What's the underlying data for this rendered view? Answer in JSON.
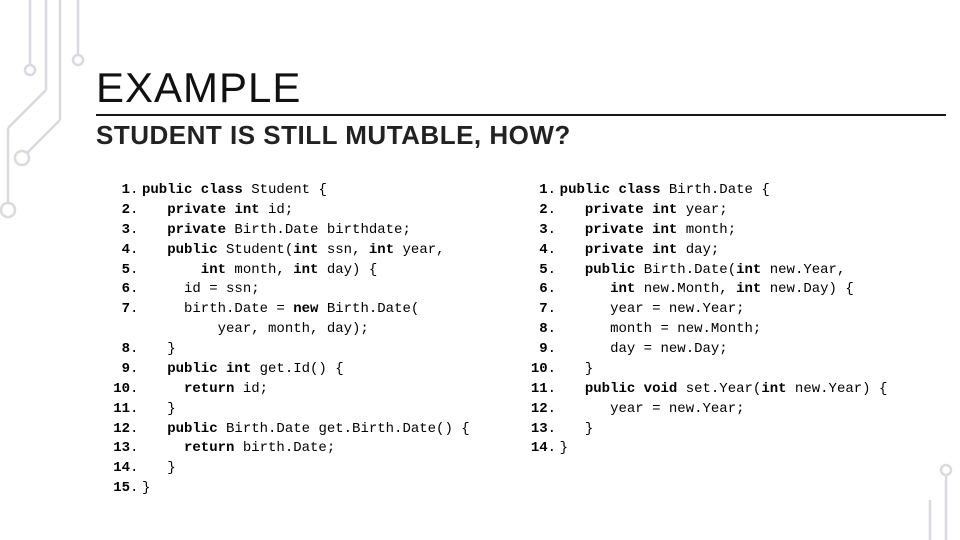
{
  "title": "EXAMPLE",
  "subtitle": "STUDENT IS STILL MUTABLE, HOW?",
  "left_lines": [
    {
      "n": "1",
      "dot": ". ",
      "t": [
        "public class",
        " Student {"
      ]
    },
    {
      "n": "2",
      "dot": ". ",
      "t": [
        "   private int",
        " id;"
      ]
    },
    {
      "n": "3",
      "dot": ". ",
      "t": [
        "   private",
        " Birth.Date birthdate;"
      ]
    },
    {
      "n": "4",
      "dot": ". ",
      "t": [
        "   public",
        " Student(",
        "int",
        " ssn, ",
        "int",
        " year,"
      ]
    },
    {
      "n": "5",
      "dot": ". ",
      "t": [
        "       int",
        " month, ",
        "int",
        " day) {"
      ]
    },
    {
      "n": "6",
      "dot": ". ",
      "t": [
        "",
        "     id = ssn;"
      ]
    },
    {
      "n": "7",
      "dot": ". ",
      "t": [
        "",
        "     birth.Date = ",
        "new",
        " Birth.Date("
      ]
    },
    {
      "n": "",
      "dot": "  ",
      "t": [
        "",
        "         year, month, day);"
      ]
    },
    {
      "n": "8",
      "dot": ". ",
      "t": [
        "",
        "   }"
      ]
    },
    {
      "n": "9",
      "dot": ". ",
      "t": [
        "   public int",
        " get.Id() {"
      ]
    },
    {
      "n": "10",
      "dot": ". ",
      "t": [
        "     return",
        " id;"
      ]
    },
    {
      "n": "11",
      "dot": ". ",
      "t": [
        "",
        "   }"
      ]
    },
    {
      "n": "12",
      "dot": ". ",
      "t": [
        "   public",
        " Birth.Date get.Birth.Date() {"
      ]
    },
    {
      "n": "13",
      "dot": ". ",
      "t": [
        "     return",
        " birth.Date;"
      ]
    },
    {
      "n": "14",
      "dot": ". ",
      "t": [
        "",
        "   }"
      ]
    },
    {
      "n": "15",
      "dot": ". ",
      "t": [
        "",
        "}"
      ]
    }
  ],
  "right_lines": [
    {
      "n": "1",
      "dot": ". ",
      "t": [
        "public class",
        " Birth.Date {"
      ]
    },
    {
      "n": "2",
      "dot": ". ",
      "t": [
        "   private int",
        " year;"
      ]
    },
    {
      "n": "3",
      "dot": ". ",
      "t": [
        "   private int",
        " month;"
      ]
    },
    {
      "n": "4",
      "dot": ". ",
      "t": [
        "   private int",
        " day;"
      ]
    },
    {
      "n": "5",
      "dot": ". ",
      "t": [
        "   public",
        " Birth.Date(",
        "int",
        " new.Year,"
      ]
    },
    {
      "n": "6",
      "dot": ". ",
      "t": [
        "      int",
        " new.Month, ",
        "int",
        " new.Day) {"
      ]
    },
    {
      "n": "7",
      "dot": ". ",
      "t": [
        "",
        "      year = new.Year;"
      ]
    },
    {
      "n": "8",
      "dot": ". ",
      "t": [
        "",
        "      month = new.Month;"
      ]
    },
    {
      "n": "9",
      "dot": ". ",
      "t": [
        "",
        "      day = new.Day;"
      ]
    },
    {
      "n": "10",
      "dot": ". ",
      "t": [
        "",
        "   }"
      ]
    },
    {
      "n": "11",
      "dot": ". ",
      "t": [
        "   public void",
        " set.Year(",
        "int",
        " new.Year) {"
      ]
    },
    {
      "n": "12",
      "dot": ". ",
      "t": [
        "",
        "      year = new.Year;"
      ]
    },
    {
      "n": "13",
      "dot": ". ",
      "t": [
        "",
        "   }"
      ]
    },
    {
      "n": "14",
      "dot": ". ",
      "t": [
        "",
        "}"
      ]
    }
  ]
}
